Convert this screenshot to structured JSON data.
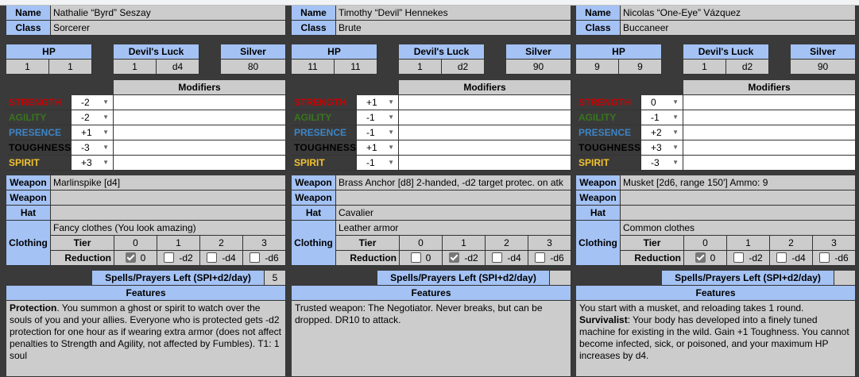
{
  "labels": {
    "name": "Name",
    "class": "Class",
    "hp": "HP",
    "devils_luck": "Devil's Luck",
    "silver": "Silver",
    "modifiers": "Modifiers",
    "weapon": "Weapon",
    "hat": "Hat",
    "clothing": "Clothing",
    "tier": "Tier",
    "reduction": "Reduction",
    "spells": "Spells/Prayers Left (SPI+d2/day)",
    "features": "Features",
    "tiers": [
      "0",
      "1",
      "2",
      "3"
    ],
    "reductions": [
      "0",
      "-d2",
      "-d4",
      "-d6"
    ],
    "stats": [
      "STRENGTH",
      "AGILITY",
      "PRESENCE",
      "TOUGHNESS",
      "SPIRIT"
    ]
  },
  "characters": [
    {
      "name": "Nathalie “Byrd” Seszay",
      "class": "Sorcerer",
      "hp": [
        "1",
        "1"
      ],
      "luck": [
        "1",
        "d4"
      ],
      "silver": "80",
      "stats": [
        "-2",
        "-2",
        "+1",
        "-3",
        "+3"
      ],
      "weapon1": "Marlinspike [d4]",
      "weapon2": "",
      "hat": "",
      "clothing": "Fancy clothes (You look amazing)",
      "reduction_checked": 0,
      "spells_left": "5",
      "features": [
        {
          "bold": "Protection",
          "text": ". You summon a ghost or spirit to watch over the souls of you and your allies. Everyone who is protected gets -d2 protection for one hour as if wearing extra armor (does not affect penalties to Strength and Agility, not affected by Fumbles). T1: 1 soul"
        }
      ]
    },
    {
      "name": "Timothy “Devil” Hennekes",
      "class": "Brute",
      "hp": [
        "11",
        "11"
      ],
      "luck": [
        "1",
        "d2"
      ],
      "silver": "90",
      "stats": [
        "+1",
        "-1",
        "-1",
        "+1",
        "-1"
      ],
      "weapon1": "Brass Anchor [d8] 2-handed, -d2 target protec. on atk",
      "weapon2": "",
      "hat": "Cavalier",
      "clothing": "Leather armor",
      "reduction_checked": 1,
      "spells_left": "",
      "features": [
        {
          "bold": "",
          "text": "Trusted weapon: The Negotiator. Never breaks, but can be dropped. DR10 to attack."
        }
      ]
    },
    {
      "name": "Nicolas “One-Eye” Vázquez",
      "class": "Buccaneer",
      "hp": [
        "9",
        "9"
      ],
      "luck": [
        "1",
        "d2"
      ],
      "silver": "90",
      "stats": [
        "0",
        "-1",
        "+2",
        "+3",
        "-3"
      ],
      "weapon1": "Musket [2d6, range 150'] Ammo: 9",
      "weapon2": "",
      "hat": "",
      "clothing": "Common clothes",
      "reduction_checked": 0,
      "spells_left": "",
      "features": [
        {
          "bold": "",
          "text": "You start with a musket, and reloading takes 1 round."
        },
        {
          "bold": "Survivalist",
          "text": ": Your body has developed into a finely tuned machine for existing in the wild. Gain +1 Toughness. You cannot become infected, sick, or poisoned, and your maximum HP increases by d4."
        }
      ]
    }
  ]
}
